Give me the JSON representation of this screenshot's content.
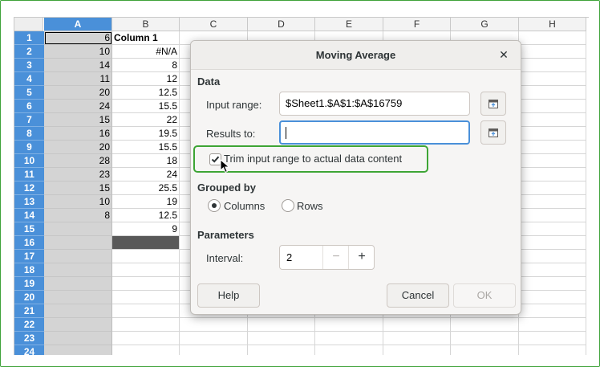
{
  "sheet": {
    "columns": [
      "A",
      "B",
      "C",
      "D",
      "E",
      "F",
      "G",
      "H"
    ],
    "rows": [
      "1",
      "2",
      "3",
      "4",
      "5",
      "6",
      "7",
      "8",
      "9",
      "10",
      "11",
      "12",
      "13",
      "14",
      "15",
      "16",
      "17",
      "18",
      "19",
      "20",
      "21",
      "22",
      "23",
      "24"
    ],
    "col_a": [
      "6",
      "10",
      "14",
      "11",
      "20",
      "24",
      "15",
      "16",
      "20",
      "28",
      "23",
      "15",
      "10",
      "8"
    ],
    "col_b_header": "Column 1",
    "col_b": [
      "#N/A",
      "8",
      "12",
      "12.5",
      "15.5",
      "22",
      "19.5",
      "15.5",
      "18",
      "24",
      "25.5",
      "19",
      "12.5",
      "9"
    ]
  },
  "dialog": {
    "title": "Moving Average",
    "close_glyph": "✕",
    "data_section": "Data",
    "input_range_label": "Input range:",
    "input_range_value": "$Sheet1.$A$1:$A$16759",
    "results_to_label": "Results to:",
    "results_to_value": "",
    "trim_label": "Trim input range to actual data content",
    "trim_checked": true,
    "grouped_by_section": "Grouped by",
    "columns_label": "Columns",
    "rows_label": "Rows",
    "grouped_by_selected": "Columns",
    "parameters_section": "Parameters",
    "interval_label": "Interval:",
    "interval_value": "2",
    "minus_glyph": "−",
    "plus_glyph": "+",
    "help_label": "Help",
    "cancel_label": "Cancel",
    "ok_label": "OK"
  },
  "colors": {
    "selection_header": "#4a90d9",
    "selected_column_fill": "#d4d4d4",
    "highlight_box": "#3ea535",
    "frame_border": "#3fa33a"
  },
  "icons": {
    "shrink": "shrink-dialog-icon",
    "close": "close-icon",
    "checkmark": "checkmark-icon",
    "cursor": "mouse-pointer-icon"
  }
}
